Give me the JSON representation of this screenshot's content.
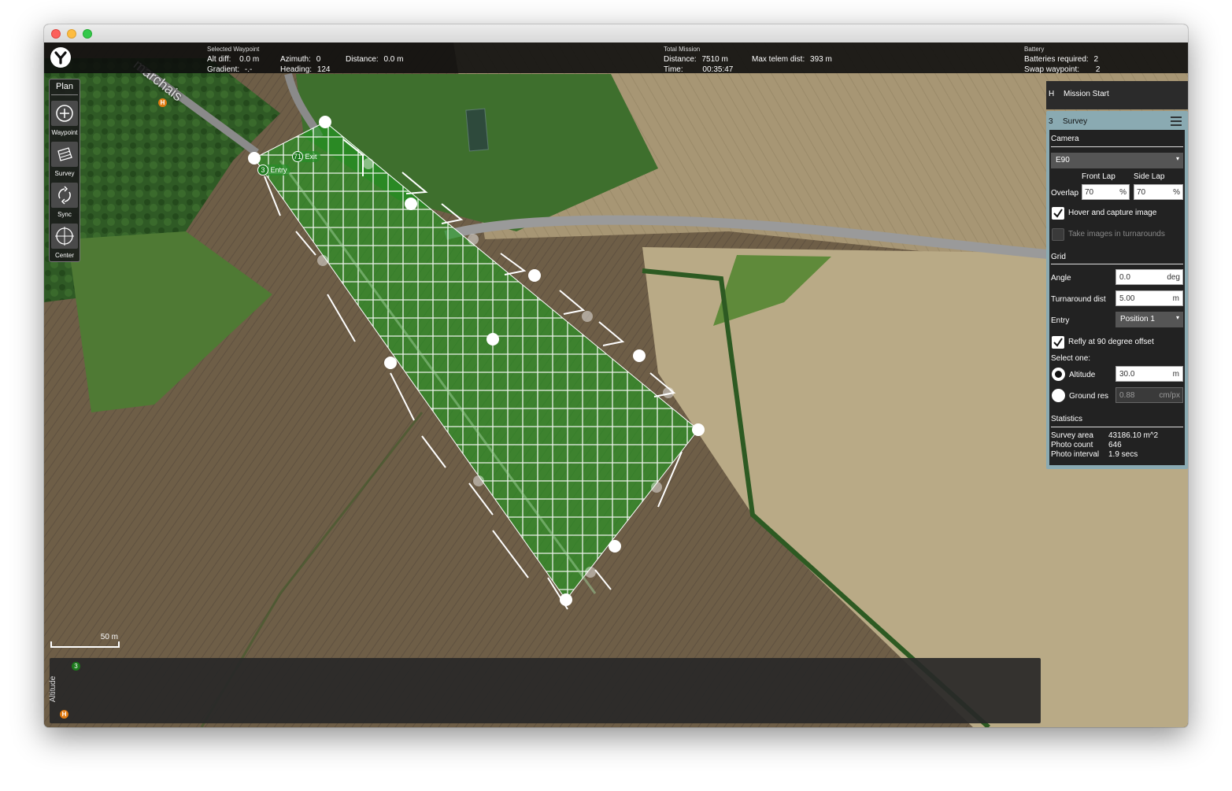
{
  "toolbar": {
    "selected_waypoint": {
      "caption": "Selected Waypoint",
      "alt_diff_label": "Alt diff:",
      "alt_diff_value": "0.0 m",
      "azimuth_label": "Azimuth:",
      "azimuth_value": "0",
      "distance_label": "Distance:",
      "distance_value": "0.0 m",
      "gradient_label": "Gradient:",
      "gradient_value": "-.-",
      "heading_label": "Heading:",
      "heading_value": "124"
    },
    "total_mission": {
      "caption": "Total Mission",
      "distance_label": "Distance:",
      "distance_value": "7510 m",
      "max_telem_label": "Max telem dist:",
      "max_telem_value": "393 m",
      "time_label": "Time:",
      "time_value": "00:35:47"
    },
    "battery": {
      "caption": "Battery",
      "required_label": "Batteries required:",
      "required_value": "2",
      "swap_label": "Swap waypoint:",
      "swap_value": "2"
    }
  },
  "plan_tools": {
    "title": "Plan",
    "items": [
      {
        "label": "Waypoint",
        "icon": "add-waypoint-icon"
      },
      {
        "label": "Survey",
        "icon": "survey-icon"
      },
      {
        "label": "Sync",
        "icon": "sync-icon"
      },
      {
        "label": "Center",
        "icon": "crosshair-icon"
      }
    ]
  },
  "map": {
    "road_label": "marchais",
    "home_marker": "H",
    "entry_marker": {
      "number": "3",
      "label": "Entry"
    },
    "exit_marker": {
      "number": "71",
      "label": "Exit"
    },
    "scale_label": "50 m",
    "colors": {
      "survey_fill": "#1f9a1f",
      "grid": "#ffffff",
      "field_brown": "#6b5a44",
      "field_tan": "#b8a98a"
    }
  },
  "mission_items": {
    "start": {
      "index": "H",
      "title": "Mission Start"
    },
    "survey": {
      "index": "3",
      "title": "Survey",
      "camera_header": "Camera",
      "camera_model": "E90",
      "front_lap_label": "Front Lap",
      "side_lap_label": "Side Lap",
      "overlap_label": "Overlap",
      "front_lap_value": "70",
      "side_lap_value": "70",
      "percent": "%",
      "hover_label": "Hover and capture image",
      "hover_checked": true,
      "turnaround_images_label": "Take images in turnarounds",
      "turnaround_images_checked": false,
      "grid_header": "Grid",
      "angle_label": "Angle",
      "angle_value": "0.0",
      "angle_unit": "deg",
      "turnaround_label": "Turnaround dist",
      "turnaround_value": "5.00",
      "turnaround_unit": "m",
      "entry_label": "Entry",
      "entry_value": "Position 1",
      "refly_label": "Refly at 90 degree offset",
      "refly_checked": true,
      "select_one_label": "Select one:",
      "altitude_label": "Altitude",
      "altitude_value": "30.0",
      "altitude_unit": "m",
      "ground_res_label": "Ground res",
      "ground_res_value": "0.88",
      "ground_res_unit": "cm/px",
      "statistics_header": "Statistics",
      "survey_area_label": "Survey area",
      "survey_area_value": "43186.10 m^2",
      "photo_count_label": "Photo count",
      "photo_count_value": "646",
      "photo_interval_label": "Photo interval",
      "photo_interval_value": "1.9 secs"
    }
  },
  "altitude_panel": {
    "label": "Altitude",
    "marker_top": "3",
    "marker_home": "H"
  }
}
